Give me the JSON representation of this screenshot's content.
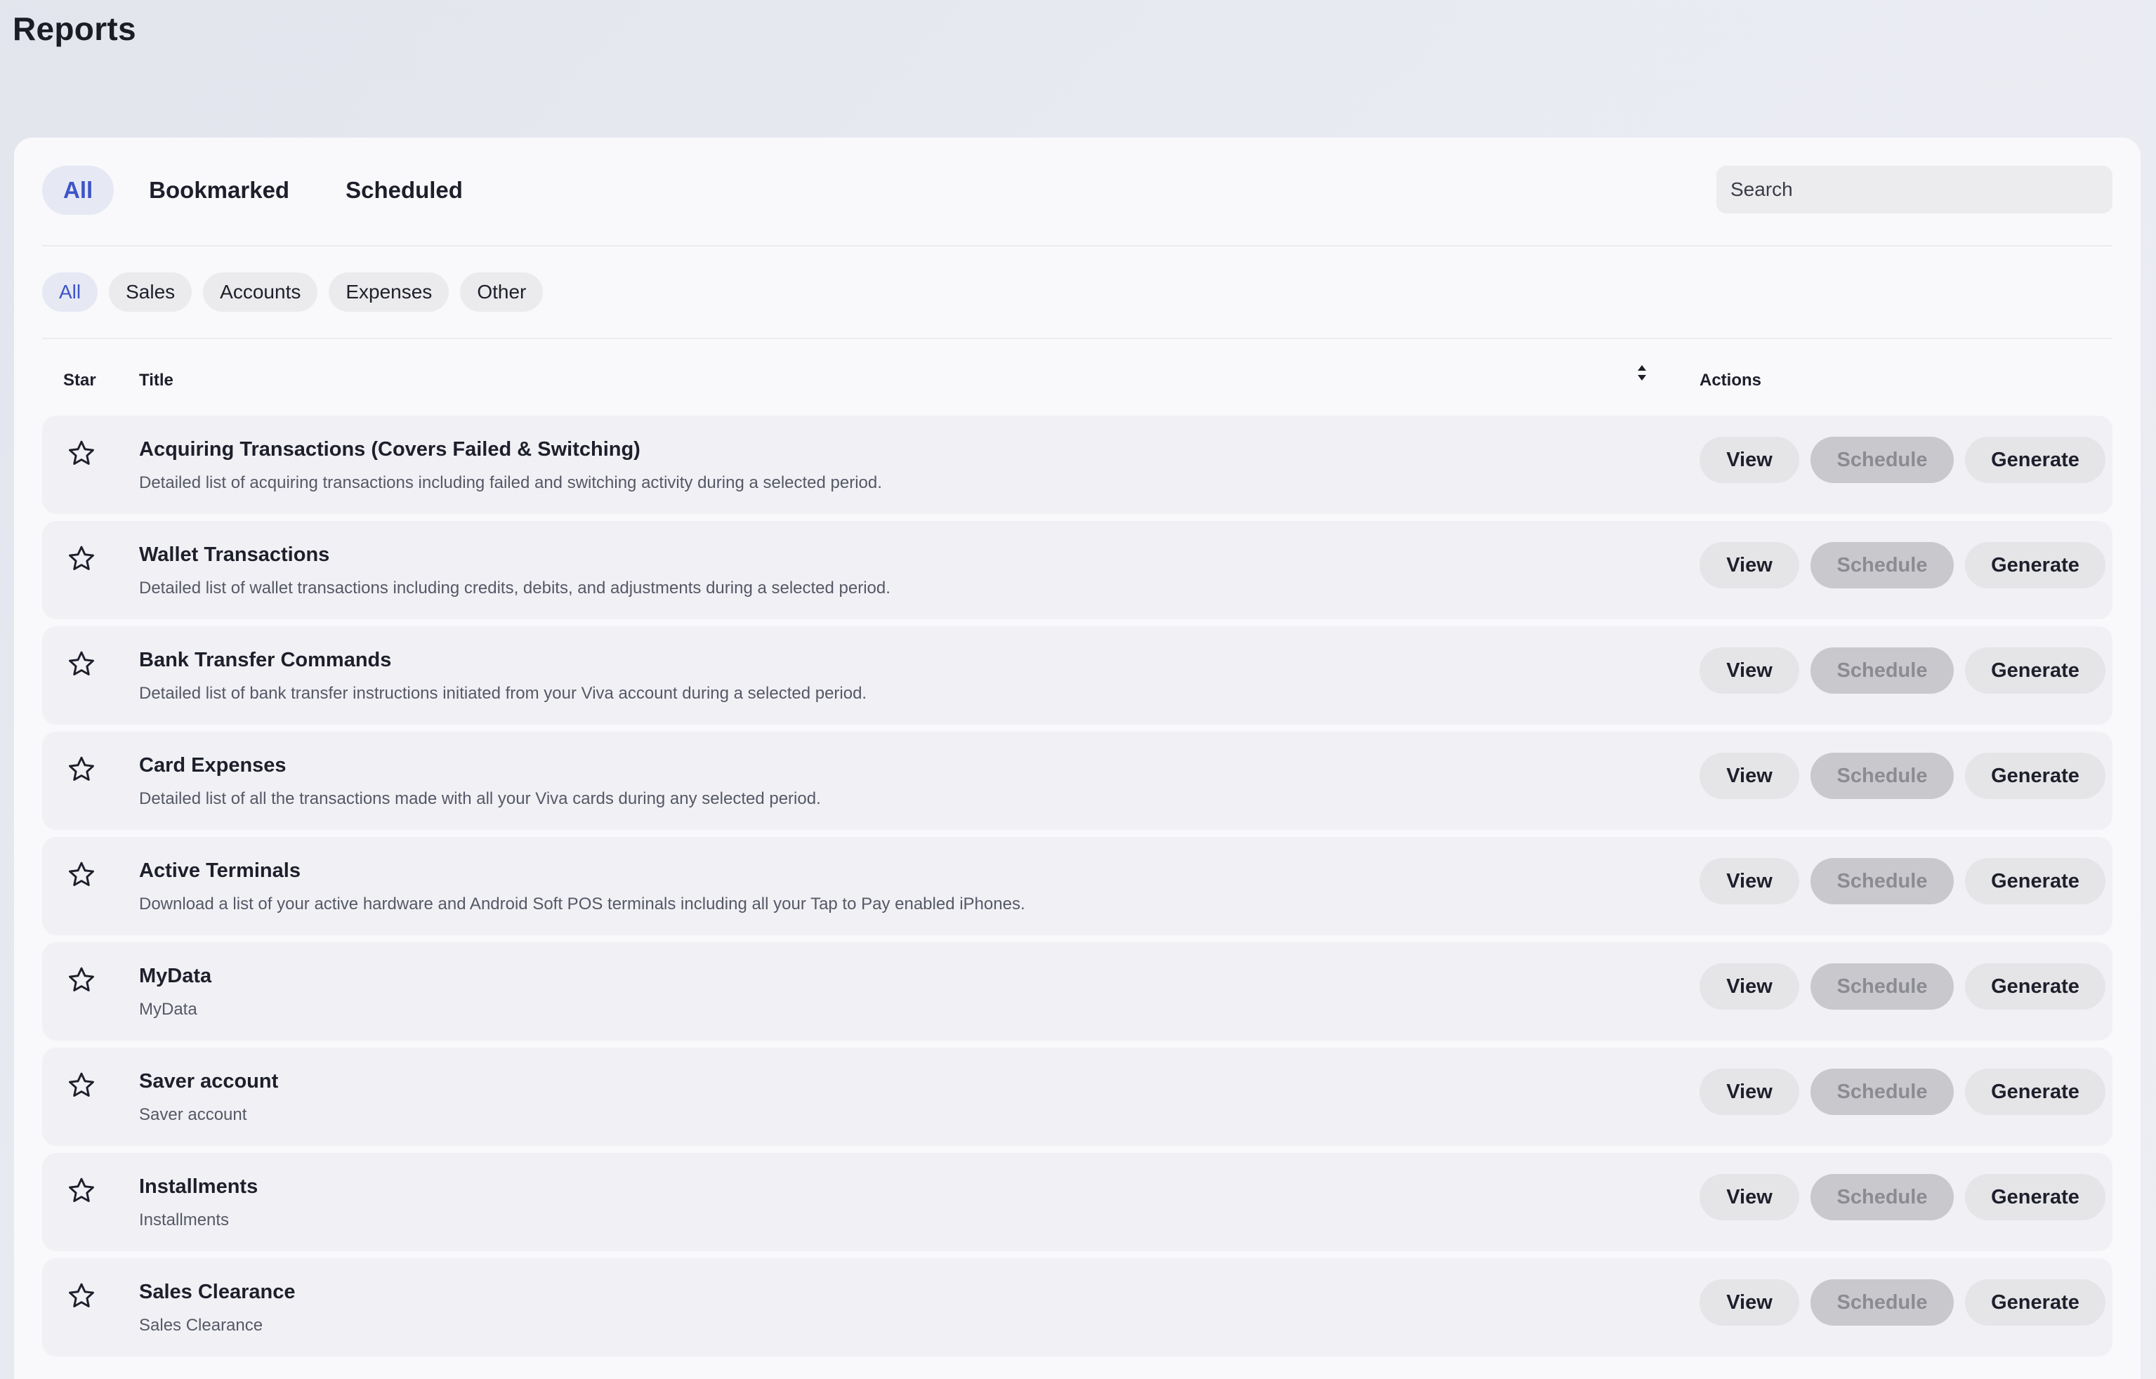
{
  "page": {
    "title": "Reports"
  },
  "tabs": [
    {
      "label": "All",
      "active": true
    },
    {
      "label": "Bookmarked",
      "active": false
    },
    {
      "label": "Scheduled",
      "active": false
    }
  ],
  "search": {
    "placeholder": "Search",
    "value": ""
  },
  "filters": [
    {
      "label": "All",
      "active": true
    },
    {
      "label": "Sales",
      "active": false
    },
    {
      "label": "Accounts",
      "active": false
    },
    {
      "label": "Expenses",
      "active": false
    },
    {
      "label": "Other",
      "active": false
    }
  ],
  "table": {
    "columns": {
      "star": "Star",
      "title": "Title",
      "actions": "Actions"
    },
    "sort_icon": "sort-up-down-icon",
    "star_icon": "star-outline-icon",
    "action_labels": {
      "view": "View",
      "schedule": "Schedule",
      "generate": "Generate"
    },
    "rows": [
      {
        "title": "Acquiring Transactions (Covers Failed & Switching)",
        "description": "Detailed list of acquiring transactions including failed and switching activity during a selected period."
      },
      {
        "title": "Wallet Transactions",
        "description": "Detailed list of wallet transactions including credits, debits, and adjustments during a selected period."
      },
      {
        "title": "Bank Transfer Commands",
        "description": "Detailed list of bank transfer instructions initiated from your Viva account during a selected period."
      },
      {
        "title": "Card Expenses",
        "description": "Detailed list of all the transactions made with all your Viva cards during any selected period."
      },
      {
        "title": "Active Terminals",
        "description": "Download a list of your active hardware and Android Soft POS terminals including all your Tap to Pay enabled iPhones."
      },
      {
        "title": "MyData",
        "description": "MyData"
      },
      {
        "title": "Saver account",
        "description": "Saver account"
      },
      {
        "title": "Installments",
        "description": "Installments"
      },
      {
        "title": "Sales Clearance",
        "description": "Sales Clearance"
      }
    ]
  },
  "colors": {
    "accent": "#3e54c7",
    "active_pill_bg": "#e6e9f4",
    "row_bg": "#f1f1f5",
    "button_bg": "#e5e5e8",
    "disabled_button_bg": "#c9c9cd",
    "disabled_button_text": "#8b8b92"
  }
}
